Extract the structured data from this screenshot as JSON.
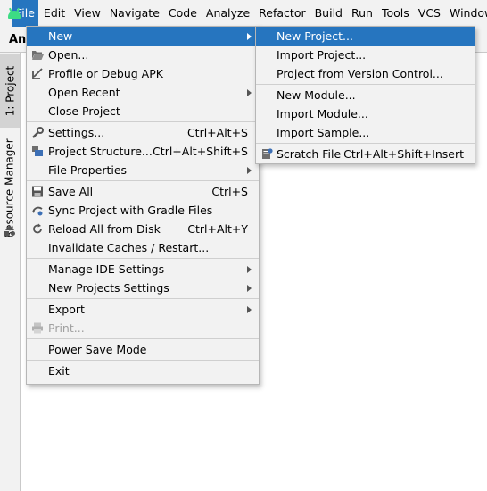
{
  "menubar": {
    "items": [
      "File",
      "Edit",
      "View",
      "Navigate",
      "Code",
      "Analyze",
      "Refactor",
      "Build",
      "Run",
      "Tools",
      "VCS",
      "Window"
    ],
    "active": "File"
  },
  "toolbar": {
    "project_name": "An"
  },
  "leftstrip": {
    "project_tab": "1: Project",
    "resource_tab": "Resource Manager"
  },
  "file_menu": {
    "new": "New",
    "open": "Open...",
    "profile_debug": "Profile or Debug APK",
    "open_recent": "Open Recent",
    "close_project": "Close Project",
    "settings": "Settings...",
    "settings_sc": "Ctrl+Alt+S",
    "project_structure": "Project Structure...",
    "project_structure_sc": "Ctrl+Alt+Shift+S",
    "file_properties": "File Properties",
    "save_all": "Save All",
    "save_all_sc": "Ctrl+S",
    "sync_gradle": "Sync Project with Gradle Files",
    "reload_disk": "Reload All from Disk",
    "reload_disk_sc": "Ctrl+Alt+Y",
    "invalidate_caches": "Invalidate Caches / Restart...",
    "manage_ide": "Manage IDE Settings",
    "new_projects_settings": "New Projects Settings",
    "export": "Export",
    "print": "Print...",
    "power_save": "Power Save Mode",
    "exit": "Exit"
  },
  "new_menu": {
    "new_project": "New Project...",
    "import_project": "Import Project...",
    "project_from_vcs": "Project from Version Control...",
    "new_module": "New Module...",
    "import_module": "Import Module...",
    "import_sample": "Import Sample...",
    "scratch_file": "Scratch File",
    "scratch_file_sc": "Ctrl+Alt+Shift+Insert"
  },
  "colors": {
    "selection": "#2675bf",
    "android_green": "#3ddc84"
  }
}
